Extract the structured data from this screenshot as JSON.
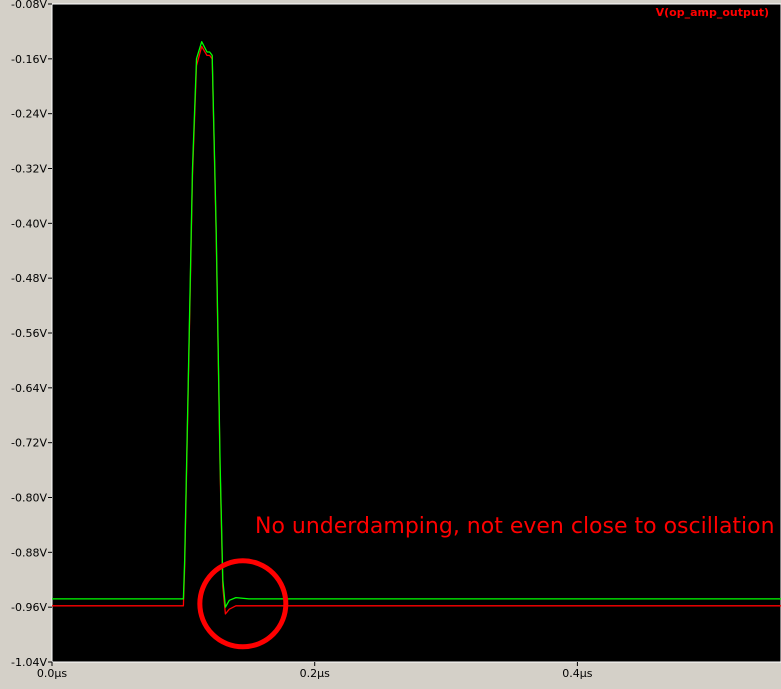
{
  "chart_data": {
    "type": "line",
    "trace_label": "V(op_amp_output)",
    "trace_label_color": "#ff0000",
    "background": "#000000",
    "grid": false,
    "xlim": [
      0.0,
      0.555
    ],
    "ylim": [
      -1.04,
      -0.08
    ],
    "x_ticks": [
      {
        "value": 0.0,
        "label": "0.0µs"
      },
      {
        "value": 0.2,
        "label": "0.2µs"
      },
      {
        "value": 0.4,
        "label": "0.4µs"
      }
    ],
    "y_ticks": [
      {
        "value": -0.08,
        "label": "-0.08V"
      },
      {
        "value": -0.16,
        "label": "-0.16V"
      },
      {
        "value": -0.24,
        "label": "-0.24V"
      },
      {
        "value": -0.32,
        "label": "-0.32V"
      },
      {
        "value": -0.4,
        "label": "-0.40V"
      },
      {
        "value": -0.48,
        "label": "-0.48V"
      },
      {
        "value": -0.56,
        "label": "-0.56V"
      },
      {
        "value": -0.64,
        "label": "-0.64V"
      },
      {
        "value": -0.72,
        "label": "-0.72V"
      },
      {
        "value": -0.8,
        "label": "-0.80V"
      },
      {
        "value": -0.88,
        "label": "-0.88V"
      },
      {
        "value": -0.96,
        "label": "-0.96V"
      },
      {
        "value": -1.04,
        "label": "-1.04V"
      }
    ],
    "series": [
      {
        "color": "#ff0000",
        "x": [
          0.0,
          0.1,
          0.101,
          0.107,
          0.11,
          0.114,
          0.118,
          0.12,
          0.122,
          0.125,
          0.128,
          0.13,
          0.132,
          0.135,
          0.14,
          0.15,
          0.555
        ],
        "y": [
          -0.958,
          -0.958,
          -0.9,
          -0.33,
          -0.17,
          -0.142,
          -0.155,
          -0.155,
          -0.16,
          -0.42,
          -0.76,
          -0.93,
          -0.97,
          -0.963,
          -0.958,
          -0.958,
          -0.958
        ]
      },
      {
        "color": "#00ff00",
        "x": [
          0.0,
          0.1,
          0.101,
          0.107,
          0.11,
          0.114,
          0.118,
          0.12,
          0.122,
          0.125,
          0.128,
          0.13,
          0.132,
          0.135,
          0.14,
          0.15,
          0.555
        ],
        "y": [
          -0.948,
          -0.948,
          -0.89,
          -0.32,
          -0.16,
          -0.135,
          -0.15,
          -0.15,
          -0.155,
          -0.41,
          -0.75,
          -0.92,
          -0.96,
          -0.95,
          -0.946,
          -0.948,
          -0.948
        ]
      }
    ],
    "annotation": {
      "text": "No underdamping, not even close to oscillation",
      "color": "#ff0000",
      "circle_center": [
        0.143,
        -0.958
      ],
      "circle_color": "#ff0000"
    }
  }
}
